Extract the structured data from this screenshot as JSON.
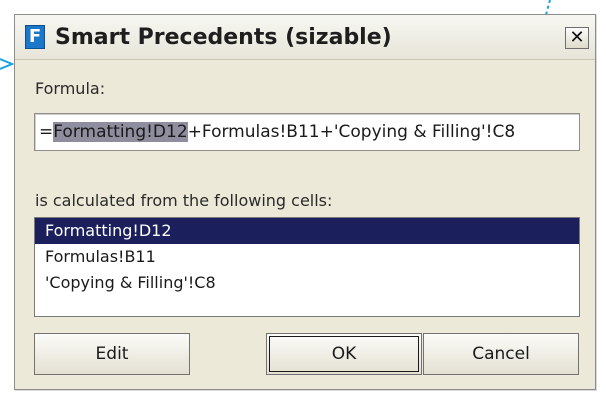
{
  "colors": {
    "callout": "#1ba0e0",
    "selection": "#1b1f5c",
    "formula_highlight": "#8e8e9e"
  },
  "window": {
    "title": "Smart Precedents (sizable)",
    "icon_letter": "F",
    "close_glyph": "✕"
  },
  "formula": {
    "label": "Formula:",
    "highlighted": "Formatting!D12",
    "prefix": "=",
    "rest": "+Formulas!B11+'Copying & Filling'!C8"
  },
  "cells": {
    "label": "is calculated from the following cells:",
    "items": [
      {
        "label": "Formatting!D12",
        "selected": true
      },
      {
        "label": "Formulas!B11",
        "selected": false
      },
      {
        "label": "'Copying & Filling'!C8",
        "selected": false
      }
    ]
  },
  "buttons": {
    "edit": "Edit",
    "ok": "OK",
    "cancel": "Cancel"
  }
}
